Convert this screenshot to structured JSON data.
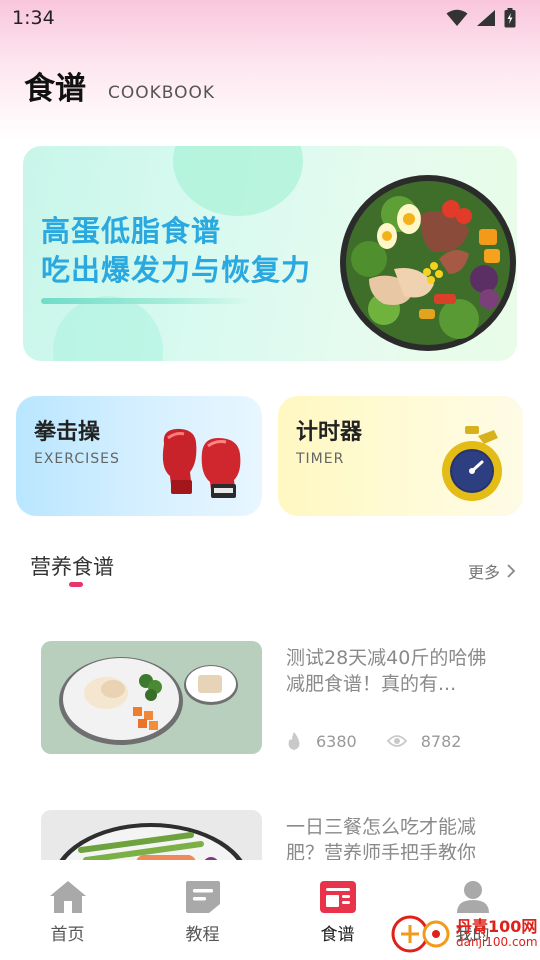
{
  "status_bar": {
    "time": "1:34",
    "icons": [
      "wifi-icon",
      "signal-icon",
      "battery-charging-icon"
    ]
  },
  "header": {
    "title": "食谱",
    "subtitle": "COOKBOOK"
  },
  "banner": {
    "line1": "高蛋低脂食谱",
    "line2": "吃出爆发力与恢复力",
    "image": "salad-bowl"
  },
  "cards": [
    {
      "title": "拳击操",
      "subtitle": "EXERCISES",
      "icon": "boxing-gloves-icon"
    },
    {
      "title": "计时器",
      "subtitle": "TIMER",
      "icon": "stopwatch-icon"
    }
  ],
  "section": {
    "title": "营养食谱",
    "more_label": "更多"
  },
  "recipes": [
    {
      "title": "测试28天减40斤的哈佛减肥食谱！真的有...",
      "likes": "6380",
      "views": "8782",
      "image": "chicken-rice-plate"
    },
    {
      "title": "一日三餐怎么吃才能减肥？营养师手把手教你",
      "image": "asparagus-salmon-plate"
    }
  ],
  "tabbar": {
    "items": [
      {
        "label": "首页",
        "icon": "home-icon",
        "active": false
      },
      {
        "label": "教程",
        "icon": "tutorial-icon",
        "active": false
      },
      {
        "label": "食谱",
        "icon": "recipe-icon",
        "active": true
      },
      {
        "label": "我的",
        "icon": "profile-icon",
        "active": false
      }
    ]
  },
  "watermark": {
    "text": "丹青100网",
    "url": "danji100.com"
  },
  "colors": {
    "accent": "#e8336b",
    "banner_text": "#2aa8e0",
    "tab_active": "#e8334a",
    "tab_inactive": "#a9a9a9"
  }
}
